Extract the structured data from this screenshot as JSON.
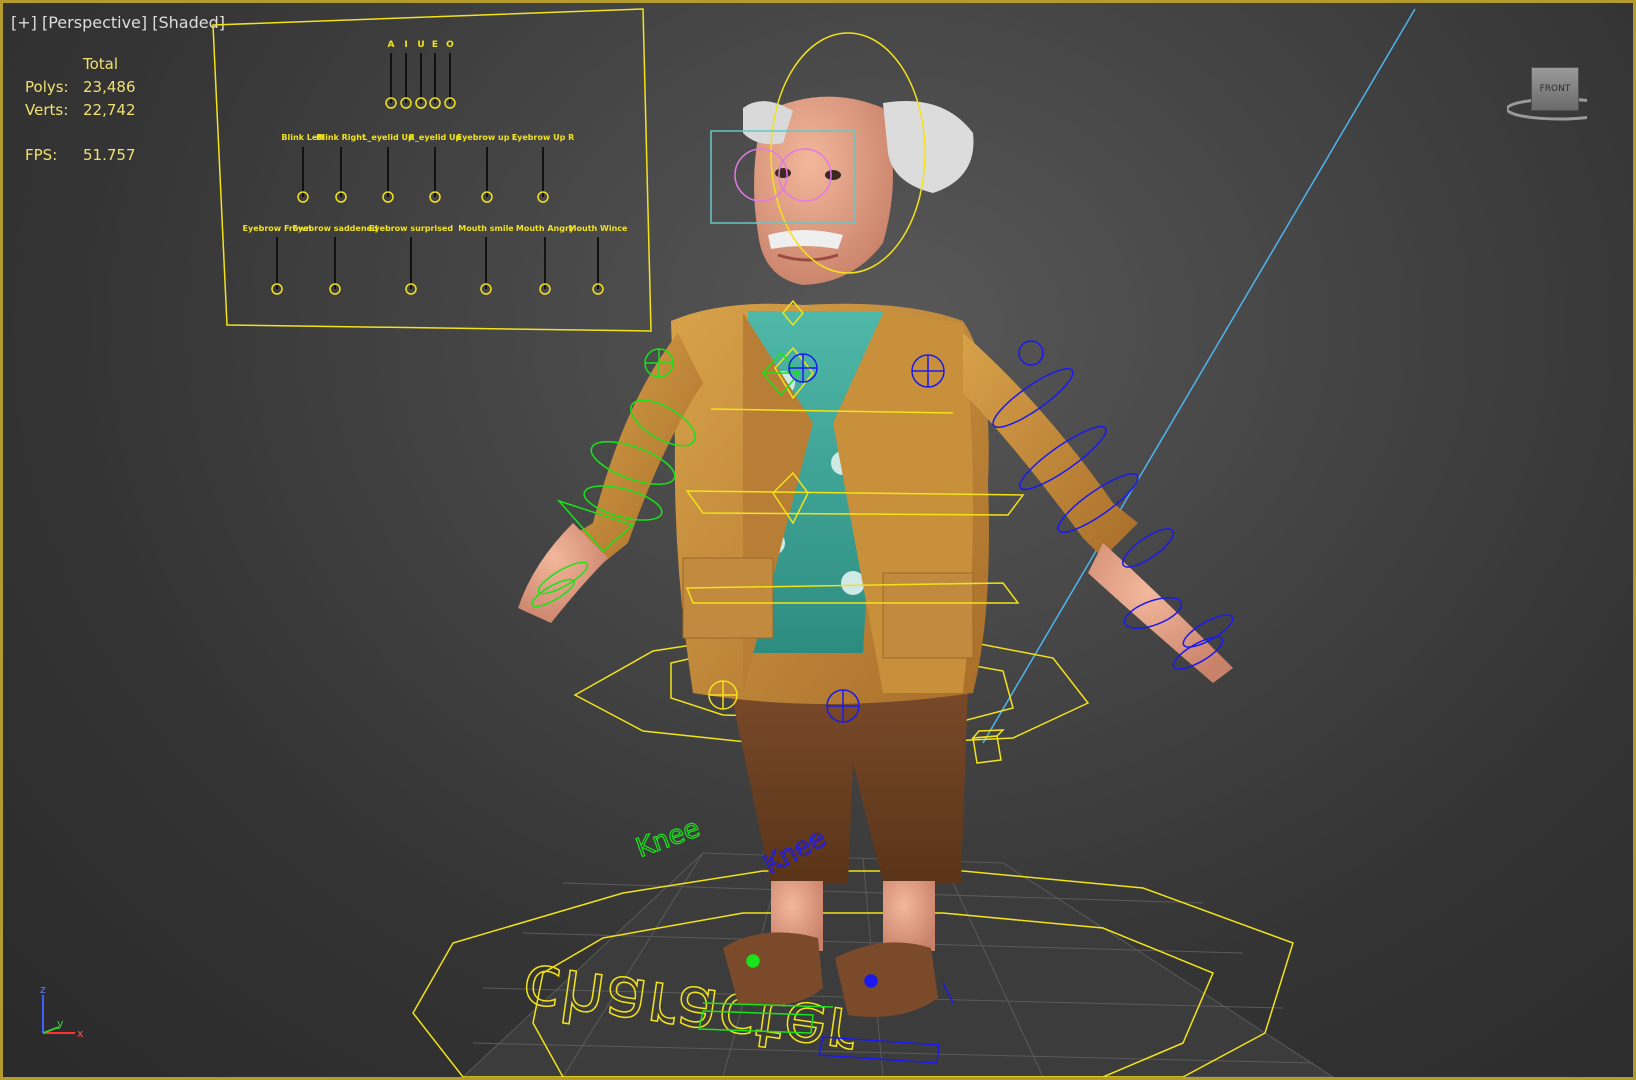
{
  "viewport": {
    "label_plus": "[+]",
    "label_view": "[Perspective]",
    "label_shading": "[Shaded]"
  },
  "stats": {
    "total_header": "Total",
    "polys_label": "Polys:",
    "polys_value": "23,486",
    "verts_label": "Verts:",
    "verts_value": "22,742",
    "fps_label": "FPS:",
    "fps_value": "51.757"
  },
  "facial_panel": {
    "top_labels": [
      "A",
      "I",
      "U",
      "E",
      "O"
    ],
    "row1_labels": [
      "Blink Left",
      "Blink Right",
      "L_eyelid Up",
      "R_eyelid Up",
      "Eyebrow up L",
      "Eyebrow Up R"
    ],
    "row2_labels": [
      "Eyebrow Frown",
      "Eyebrow saddened",
      "Eyebrow surprised",
      "Mouth smile",
      "Mouth Angry",
      "Mouth Wince"
    ]
  },
  "rig_labels": {
    "left_knee": "Knee",
    "right_knee": "Knee"
  },
  "floor_text": "character",
  "viewcube": {
    "face": "FRONT"
  },
  "axes": {
    "z": "z",
    "y": "y",
    "x": "x"
  },
  "colors": {
    "frame": "#b59a2e",
    "stats_text": "#f0e070",
    "rig_yellow": "#f2e21a",
    "rig_green": "#19e319",
    "rig_blue": "#1a1aef",
    "light_line": "#4fb4ee"
  }
}
